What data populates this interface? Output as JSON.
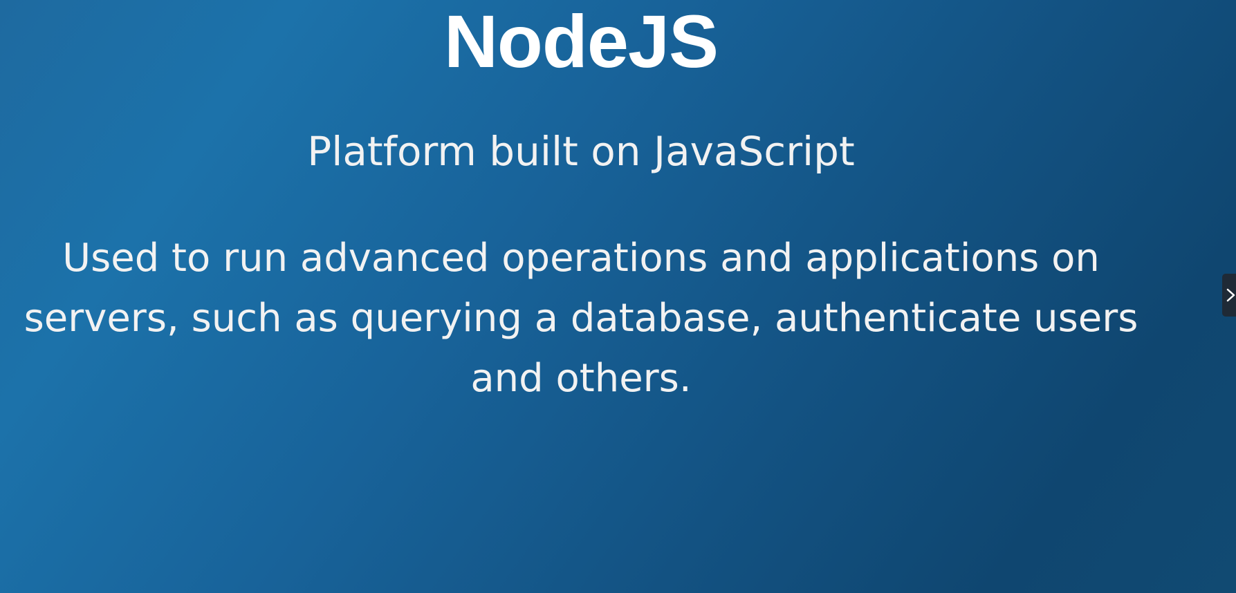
{
  "slide": {
    "title": "NodeJS",
    "subtitle": "Platform built on JavaScript",
    "body_lines": [
      "Used to run advanced operations  and applications on",
      "servers, such as querying a database, authenticate users",
      "and others."
    ]
  },
  "controls": {
    "next_icon": "chevron-right-icon"
  },
  "colors": {
    "background_start": "#1e6aa0",
    "background_end": "#0f4670",
    "text": "#ffffff"
  }
}
